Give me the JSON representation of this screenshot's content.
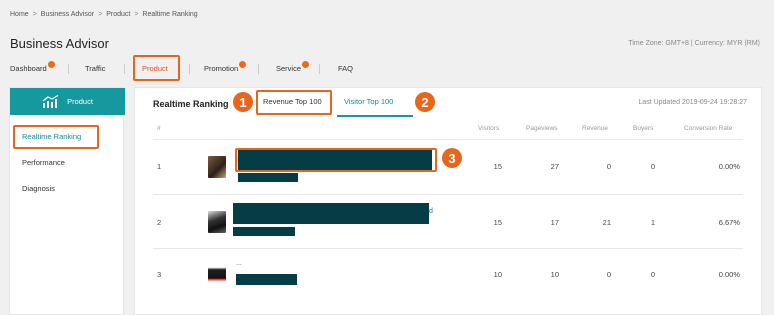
{
  "breadcrumb": [
    "Home",
    "Business Advisor",
    "Product",
    "Realtime Ranking"
  ],
  "breadcrumb_sep": ">",
  "app_title": "Business Advisor",
  "timezone_text": "Time Zone: GMT+8 | Currency: MYR (RM)",
  "nav": {
    "dashboard": "Dashboard",
    "traffic": "Traffic",
    "product": "Product",
    "promotion": "Promotion",
    "service": "Service",
    "faq": "FAQ"
  },
  "sidebar": {
    "header": "Product",
    "header_icon": "bar-chart-trend-icon",
    "items": [
      "Realtime Ranking",
      "Performance",
      "Diagnosis"
    ]
  },
  "main": {
    "title": "Realtime Ranking",
    "tabs": [
      "Revenue Top 100",
      "Visitor Top 100"
    ],
    "last_updated": "Last Updated 2019-09-24 19:28:27",
    "columns": [
      "#",
      "Visitors",
      "Pageviews",
      "Revenue",
      "Buyers",
      "Conversion Rate"
    ],
    "rows": [
      {
        "rank": "1",
        "visitors": "15",
        "pageviews": "27",
        "revenue": "0",
        "buyers": "0",
        "conversion": "0.00%",
        "name_fragment": ""
      },
      {
        "rank": "2",
        "visitors": "15",
        "pageviews": "17",
        "revenue": "21",
        "buyers": "1",
        "conversion": "6.67%",
        "name_fragment": "d"
      },
      {
        "rank": "3",
        "visitors": "10",
        "pageviews": "10",
        "revenue": "0",
        "buyers": "0",
        "conversion": "0.00%",
        "name_fragment": "..."
      }
    ]
  },
  "annotations": [
    "1",
    "2",
    "3"
  ],
  "colors": {
    "accent_teal": "#15999f",
    "highlight_orange": "#e8651c",
    "redaction": "#053c45",
    "notification_dot": "#ee6a16"
  }
}
